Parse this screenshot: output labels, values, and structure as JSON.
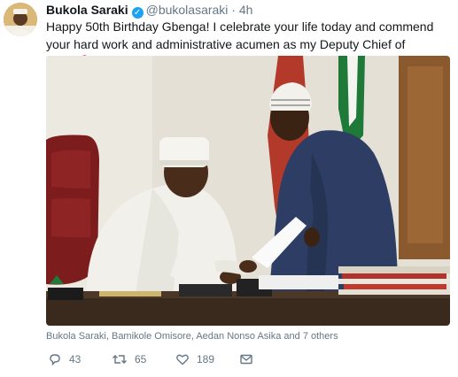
{
  "tweet": {
    "author_name": "Bukola Saraki",
    "handle": "@bukolasaraki",
    "separator": "·",
    "time": "4h",
    "text": "Happy 50th Birthday Gbenga! I celebrate your life today and commend your hard work and administrative acumen as my Deputy Chief of Staff!",
    "text_icon": "balloon-icon",
    "photo_caption": "Bukola Saraki, Bamikole Omisore, Aedan Nonso Asika and 7 others"
  },
  "actions": {
    "reply_count": "43",
    "retweet_count": "65",
    "like_count": "189"
  },
  "colors": {
    "verified": "#1da1f2",
    "muted_text": "#657786",
    "balloon": "#e0245e"
  }
}
